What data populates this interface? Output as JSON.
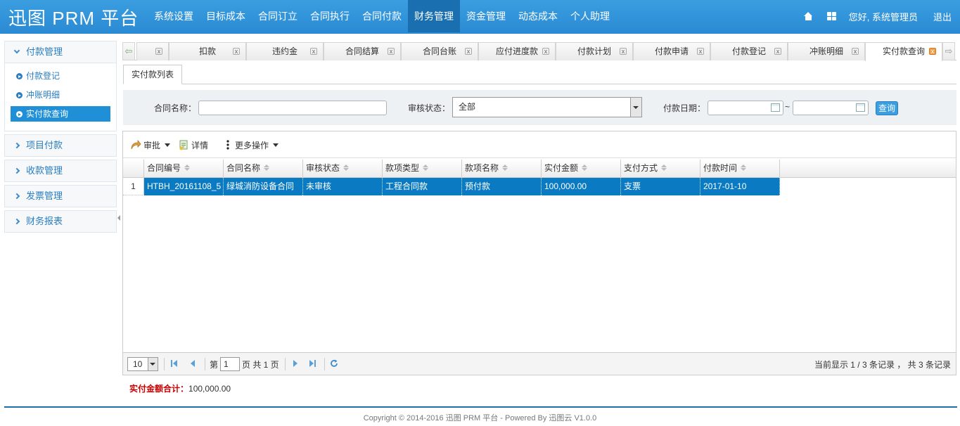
{
  "app": {
    "brand": "迅图 PRM 平台"
  },
  "nav": [
    "系统设置",
    "目标成本",
    "合同订立",
    "合同执行",
    "合同付款",
    "财务管理",
    "资金管理",
    "动态成本",
    "个人助理"
  ],
  "nav_active": "财务管理",
  "user": {
    "greeting": "您好, 系统管理员",
    "logout": "退出"
  },
  "sidebar": {
    "groups": [
      {
        "label": "付款管理",
        "open": true,
        "items": [
          "付款登记",
          "冲账明细",
          "实付款查询"
        ],
        "active_item": "实付款查询"
      },
      {
        "label": "项目付款"
      },
      {
        "label": "收款管理"
      },
      {
        "label": "发票管理"
      },
      {
        "label": "财务报表"
      }
    ]
  },
  "tabs": [
    {
      "label": ""
    },
    {
      "label": "扣款"
    },
    {
      "label": "违约金"
    },
    {
      "label": "合同结算"
    },
    {
      "label": "合同台账"
    },
    {
      "label": "应付进度款"
    },
    {
      "label": "付款计划"
    },
    {
      "label": "付款申请"
    },
    {
      "label": "付款登记"
    },
    {
      "label": "冲账明细"
    },
    {
      "label": "实付款查询",
      "active": true
    }
  ],
  "subtab": "实付款列表",
  "filter": {
    "contract_name_label": "合同名称：",
    "contract_name_value": "",
    "audit_status_label": "审核状态：",
    "audit_status_value": "全部",
    "pay_date_label": "付款日期：",
    "date_from": "",
    "date_sep": "~",
    "date_to": "",
    "query_button": "查询"
  },
  "toolbar": {
    "approve": "审批",
    "detail": "详情",
    "more": "更多操作"
  },
  "table": {
    "columns": [
      "合同编号",
      "合同名称",
      "审核状态",
      "款项类型",
      "款项名称",
      "实付金额",
      "支付方式",
      "付款时间"
    ],
    "rows": [
      {
        "num": "1",
        "cells": [
          "HTBH_20161108_5",
          "绿城消防设备合同",
          "未审核",
          "工程合同款",
          "预付款",
          "100,000.00",
          "支票",
          "2017-01-10"
        ],
        "selected": true
      }
    ]
  },
  "pager": {
    "page_size": "10",
    "page_label_pre": "第",
    "page_value": "1",
    "page_label_post": "页 共 1 页",
    "summary": "当前显示 1 / 3 条记录 ， 共 3 条记录"
  },
  "total": {
    "label": "实付金额合计：",
    "value": "100,000.00"
  },
  "footer": {
    "copyright": "Copyright © 2014-2016 迅图 PRM 平台 - Powered By 迅图云 V1.0.0"
  },
  "colors": {
    "header": "#2a8ad4",
    "nav_active": "#1a6fb0",
    "selection": "#0a7ac2",
    "total_label": "#cc0000"
  }
}
